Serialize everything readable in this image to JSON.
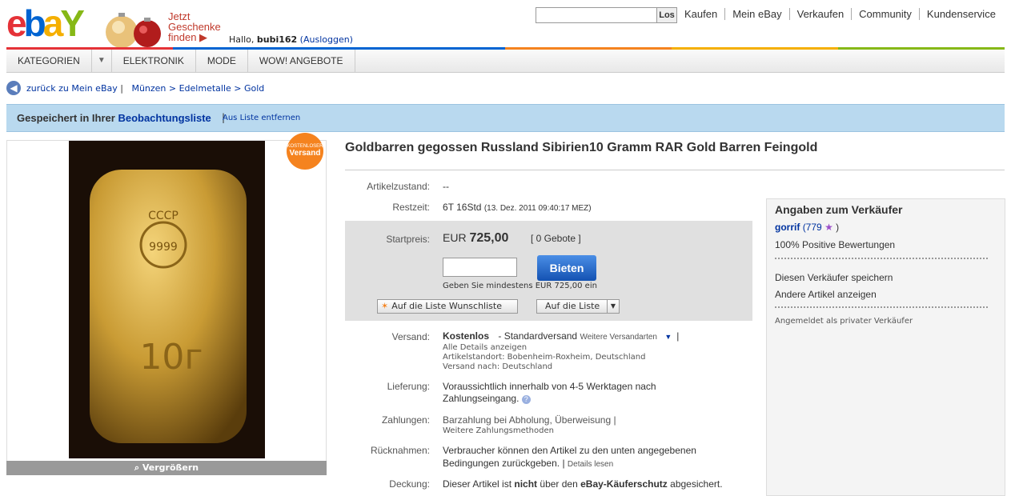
{
  "colors": {
    "accent": "#0033a0",
    "banner": "#b9d9ef",
    "orange": "#f5831f",
    "bid_button": "#1d5bc0"
  },
  "header": {
    "logo": "ebay",
    "promo_line1": "Jetzt",
    "promo_line2": "Geschenke",
    "promo_line3": "finden ▶",
    "greeting": "Hallo,",
    "username": "bubi162",
    "logout": "(Ausloggen)",
    "search_button": "Los",
    "nav": [
      "Kaufen",
      "Mein eBay",
      "Verkaufen",
      "Community",
      "Kundenservice"
    ]
  },
  "catbar": {
    "categories": "KATEGORIEN",
    "items": [
      "ELEKTRONIK",
      "MODE",
      "WOW! ANGEBOTE"
    ]
  },
  "breadcrumb": {
    "back": "zurück zu Mein eBay",
    "path": "Münzen > Edelmetalle > Gold"
  },
  "watch_banner": {
    "text": "Gespeichert in Ihrer",
    "link": "Beobachtungsliste",
    "remove": "Aus Liste entfernen"
  },
  "image": {
    "badge_line1": "KOSTENLOSER",
    "badge_line2": "Versand",
    "zoom": "Vergrößern",
    "bar_top_text": "CCCP",
    "bar_stamp": "9999",
    "bar_weight": "10г"
  },
  "item": {
    "title": "Goldbarren gegossen Russland Sibirien10 Gramm RAR Gold Barren Feingold",
    "condition_label": "Artikelzustand:",
    "condition_value": "--",
    "time_label": "Restzeit:",
    "time_value": "6T 16Std",
    "time_detail": "(13. Dez. 2011 09:40:17 MEZ)",
    "price_label": "Startpreis:",
    "price_currency": "EUR",
    "price_value": "725,00",
    "bids": "[ 0 Gebote ]",
    "bid_button": "Bieten",
    "bid_hint": "Geben Sie mindestens EUR 725,00 ein",
    "wishlist": "Auf die Liste Wunschliste",
    "list": "Auf die Liste",
    "shipping_label": "Versand:",
    "shipping_value": "Kostenlos",
    "shipping_method": "- Standardversand",
    "shipping_more": "Weitere Versandarten",
    "shipping_details": "Alle Details anzeigen",
    "shipping_location": "Artikelstandort: Bobenheim-Roxheim, Deutschland",
    "shipping_to": "Versand nach: Deutschland",
    "delivery_label": "Lieferung:",
    "delivery_line1": "Voraussichtlich innerhalb von 4-5 Werktagen nach",
    "delivery_line2": "Zahlungseingang.",
    "payment_label": "Zahlungen:",
    "payment_value": "Barzahlung bei Abholung, Überweisung |",
    "payment_more": "Weitere Zahlungsmethoden",
    "returns_label": "Rücknahmen:",
    "returns_line1": "Verbraucher können den Artikel zu den unten angegebenen",
    "returns_line2": "Bedingungen zurückgeben. |",
    "returns_link": "Details lesen",
    "coverage_label": "Deckung:",
    "coverage_pre": "Dieser Artikel ist",
    "coverage_bold": "nicht",
    "coverage_mid": "über den",
    "coverage_bold2": "eBay-Käuferschutz",
    "coverage_post": "abgesichert."
  },
  "seller": {
    "heading": "Angaben zum Verkäufer",
    "name": "gorrif",
    "score": "(779",
    "score_close": ")",
    "positive": "100% Positive Bewertungen",
    "save": "Diesen Verkäufer speichern",
    "other": "Andere Artikel anzeigen",
    "type": "Angemeldet als privater Verkäufer"
  }
}
